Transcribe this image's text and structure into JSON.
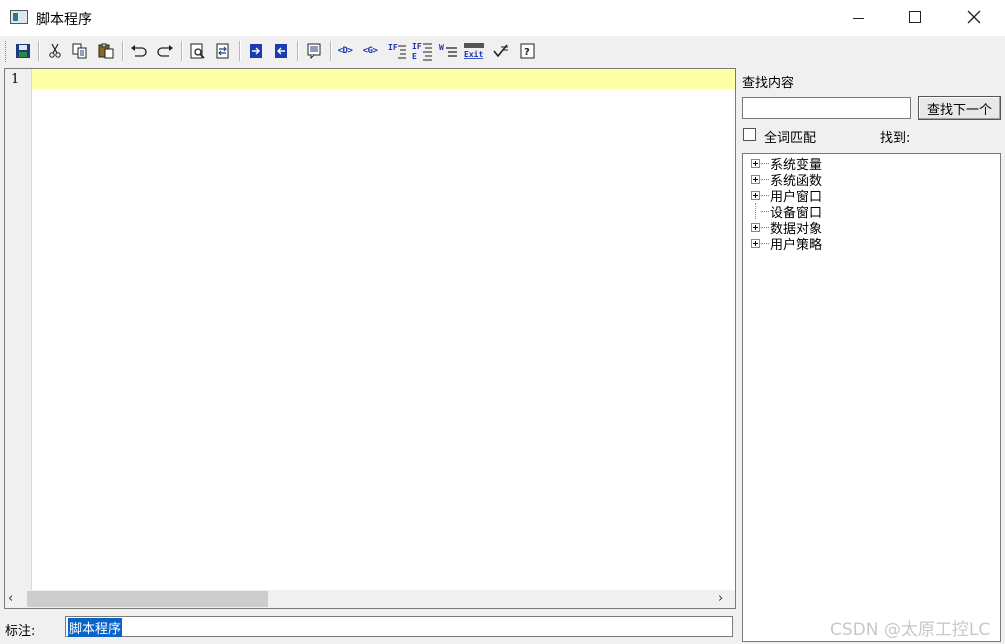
{
  "window": {
    "title": "脚本程序"
  },
  "toolbar": {
    "buttons": [
      "save-icon",
      "cut-icon",
      "copy-icon",
      "paste-icon",
      "undo-icon",
      "redo-icon",
      "find-icon",
      "replace-icon",
      "indent-icon",
      "outdent-icon",
      "comment-icon",
      "insert-data-icon",
      "insert-global-icon",
      "if-then-icon",
      "if-else-icon",
      "while-icon",
      "exit-icon",
      "check-icon",
      "help-icon"
    ],
    "labels": {
      "data": "<D>",
      "global": "<G>",
      "if": "IF",
      "if2": "IF",
      "while": "W",
      "exit": "Exit"
    }
  },
  "editor": {
    "lines": [
      "1"
    ],
    "current_line_color": "#ffffa8"
  },
  "note": {
    "label": "标注:",
    "value": "脚本程序"
  },
  "search": {
    "label": "查找内容",
    "value": "",
    "next_button": "查找下一个",
    "whole_word_label": "全词匹配",
    "whole_word_checked": false,
    "found_label": "找到:"
  },
  "tree": {
    "items": [
      {
        "label": "系统变量",
        "expandable": true
      },
      {
        "label": "系统函数",
        "expandable": true
      },
      {
        "label": "用户窗口",
        "expandable": true
      },
      {
        "label": "设备窗口",
        "expandable": false
      },
      {
        "label": "数据对象",
        "expandable": true
      },
      {
        "label": "用户策略",
        "expandable": true
      }
    ]
  },
  "watermark": "CSDN @太原工控LC"
}
